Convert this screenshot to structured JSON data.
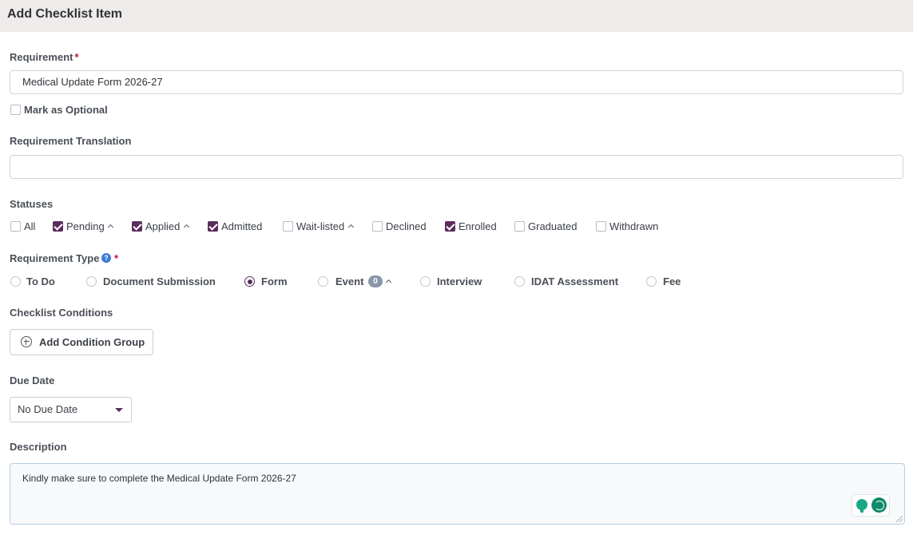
{
  "header": {
    "title": "Add Checklist Item"
  },
  "requirement": {
    "label": "Requirement",
    "required_mark": "*",
    "value": "Medical Update Form 2026-27",
    "optional_checkbox": {
      "label": "Mark as Optional",
      "checked": false
    }
  },
  "translation": {
    "label": "Requirement Translation",
    "value": ""
  },
  "statuses": {
    "label": "Statuses",
    "items": [
      {
        "label": "All",
        "checked": false,
        "expandable": false
      },
      {
        "label": "Pending",
        "checked": true,
        "expandable": true
      },
      {
        "label": "Applied",
        "checked": true,
        "expandable": true
      },
      {
        "label": "Admitted",
        "checked": true,
        "expandable": false
      },
      {
        "label": "Wait-listed",
        "checked": false,
        "expandable": true
      },
      {
        "label": "Declined",
        "checked": false,
        "expandable": false
      },
      {
        "label": "Enrolled",
        "checked": true,
        "expandable": false
      },
      {
        "label": "Graduated",
        "checked": false,
        "expandable": false
      },
      {
        "label": "Withdrawn",
        "checked": false,
        "expandable": false
      }
    ]
  },
  "requirement_type": {
    "label": "Requirement Type",
    "required_mark": "*",
    "help_icon": "question-circle-icon",
    "selected": "Form",
    "options": [
      {
        "label": "To Do",
        "checked": false
      },
      {
        "label": "Document Submission",
        "checked": false
      },
      {
        "label": "Form",
        "checked": true
      },
      {
        "label": "Event",
        "checked": false,
        "badge": "0"
      },
      {
        "label": "Interview",
        "checked": false
      },
      {
        "label": "IDAT Assessment",
        "checked": false
      },
      {
        "label": "Fee",
        "checked": false
      }
    ]
  },
  "conditions": {
    "label": "Checklist Conditions",
    "button_label": "Add Condition Group",
    "button_icon": "plus-circle-icon"
  },
  "due_date": {
    "label": "Due Date",
    "selected": "No Due Date"
  },
  "description": {
    "label": "Description",
    "value": "Kindly make sure to complete the Medical Update Form 2026-27"
  },
  "colors": {
    "accent": "#5b2d5e",
    "required": "#c8102e",
    "help": "#3a7bd5",
    "header_bg": "#efebea",
    "assistant": "#0f8a6a"
  }
}
